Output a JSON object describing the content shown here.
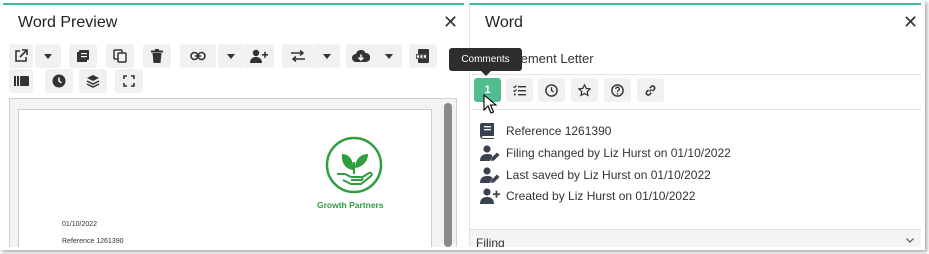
{
  "left_panel": {
    "title": "Word Preview",
    "close": "✕",
    "document": {
      "brand_name": "Growth Partners",
      "date": "01/10/2022",
      "reference": "Reference 1261390"
    }
  },
  "right_panel": {
    "title": "Word",
    "close": "✕",
    "document_name": "Engagement Letter",
    "comments_count": "1",
    "tooltip": "Comments",
    "info": [
      {
        "icon": "book-icon",
        "text": "Reference 1261390"
      },
      {
        "icon": "user-edit-icon",
        "text": "Filing changed by Liz Hurst on 01/10/2022"
      },
      {
        "icon": "user-edit-icon",
        "text": "Last saved by Liz Hurst on 01/10/2022"
      },
      {
        "icon": "user-plus-icon",
        "text": "Created by Liz Hurst on 01/10/2022"
      }
    ],
    "section": {
      "title": "Filing"
    }
  },
  "colors": {
    "accent": "#3dbd8e",
    "active_button": "#4fbd8f",
    "logo_green": "#2e9e3e",
    "tooltip_bg": "#2d2d2d"
  }
}
